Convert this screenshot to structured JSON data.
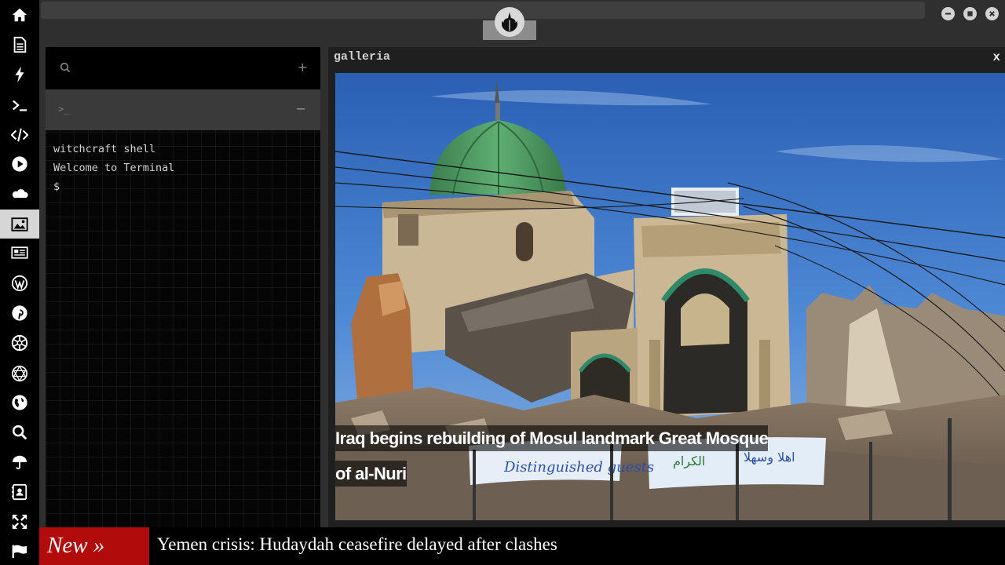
{
  "sidebar": {
    "icons": [
      "home-icon",
      "document-icon",
      "lightning-icon",
      "terminal-icon",
      "code-icon",
      "play-icon",
      "cloud-icon",
      "image-icon",
      "newspaper-icon",
      "wordpress-icon",
      "pinterest-icon",
      "aperture-icon",
      "network-globe-icon",
      "globe-icon",
      "search-icon",
      "umbrella-icon",
      "contacts-icon",
      "expand-icon",
      "flag-icon"
    ],
    "active": "image-icon"
  },
  "terminal": {
    "prompt_symbol": ">_",
    "add_symbol": "+",
    "collapse_symbol": "−",
    "lines": [
      "witchcraft shell",
      "Welcome to Terminal",
      "$"
    ]
  },
  "gallery": {
    "title": "galleria",
    "close_label": "x",
    "caption_line1": " Iraq begins rebuilding of Mosul landmark Great Mosque",
    "caption_line2": "of al-Nuri",
    "banner_text": "Distinguished guests"
  },
  "ticker": {
    "label": "New »",
    "headline": "Yemen crisis: Hudaydah ceasefire delayed after clashes"
  },
  "colors": {
    "ticker_red": "#b20b0b",
    "sidebar_bg": "#000000",
    "active_icon_bg": "#d6d6d6",
    "mosque_dome": "#4e9a62"
  }
}
